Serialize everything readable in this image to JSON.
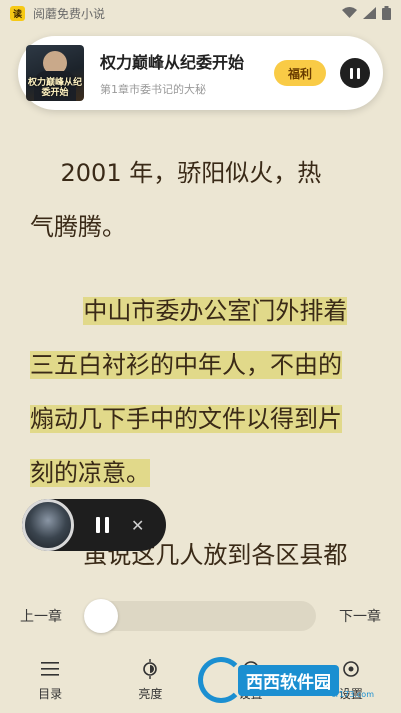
{
  "status_bar": {
    "app_icon_text": "读",
    "title": "阅蘑免费小说"
  },
  "now_playing": {
    "cover_text": "权力巅峰从纪委开始",
    "title": "权力巅峰从纪委开始",
    "subtitle": "第1章市委书记的大秘",
    "welfare_label": "福利"
  },
  "reader": {
    "paragraphs": [
      "2001 年，骄阳似火，热气腾腾。",
      "中山市委办公室门外排着三五白衬衫的中年人，不由的煽动几下手中的文件以得到片刻的凉意。",
      "虽说这几人放到各区县都"
    ],
    "line_1a": "    2001 年，骄阳似火，热",
    "line_1b": "气腾腾。",
    "line_2a": "中山市委办公室门外排着",
    "line_2b": "三五白衬衫的中年人，不由的",
    "line_2c": "煽动几下手中的文件以得到片",
    "line_2d": "刻的凉意。",
    "line_3a": "虽说这几人放到各区县都"
  },
  "chapter_bar": {
    "prev_label": "上一章",
    "next_label": "下一章",
    "progress": 0
  },
  "bottom_nav": [
    {
      "label": "目录",
      "icon": "list-icon"
    },
    {
      "label": "亮度",
      "icon": "brightness-icon"
    },
    {
      "label": "设置",
      "icon": "settings-icon"
    },
    {
      "label": "设置",
      "icon": "settings-icon"
    }
  ],
  "watermark": {
    "text": "西西软件园",
    "url": "cr173.com"
  },
  "colors": {
    "background": "#ece6d3",
    "highlight": "#e1d98a",
    "welfare": "#f9cb46"
  }
}
